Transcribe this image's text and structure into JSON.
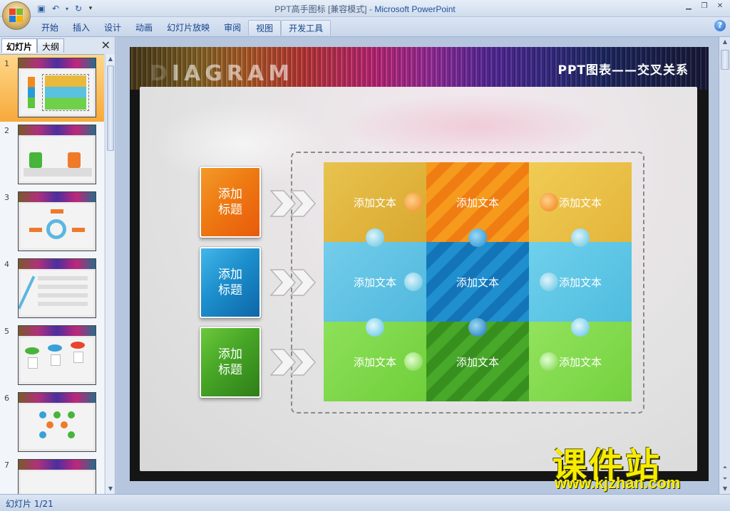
{
  "app": {
    "title_file": "PPT高手图标 [兼容模式]",
    "title_sep": "-",
    "title_app": "Microsoft PowerPoint"
  },
  "quick_access": [
    "save-icon",
    "undo-icon",
    "redo-icon",
    "customize-icon"
  ],
  "ribbon": {
    "tabs": [
      "开始",
      "插入",
      "设计",
      "动画",
      "幻灯片放映",
      "审阅",
      "视图",
      "开发工具"
    ]
  },
  "panel": {
    "tabs": [
      "幻灯片",
      "大纲"
    ],
    "thumbnails": [
      "1",
      "2",
      "3",
      "4",
      "5",
      "6",
      "7"
    ]
  },
  "slide": {
    "banner_word": "IAGRAM",
    "title": "PPT图表——交叉关系",
    "row_labels": [
      "添加\n标题",
      "添加\n标题",
      "添加\n标题"
    ],
    "cells": [
      [
        "添加文本",
        "添加文本",
        "添加文本"
      ],
      [
        "添加文本",
        "添加文本",
        "添加文本"
      ],
      [
        "添加文本",
        "添加文本",
        "添加文本"
      ]
    ]
  },
  "watermark": {
    "cn": "课件站",
    "url": "www.kjzhan.com"
  },
  "status": {
    "slide_info": "幻灯片 1/21"
  },
  "colors": {
    "orange": "#f08a1c",
    "blue": "#2a9bd6",
    "green": "#5fc43a",
    "accent_title": "#15428b"
  }
}
